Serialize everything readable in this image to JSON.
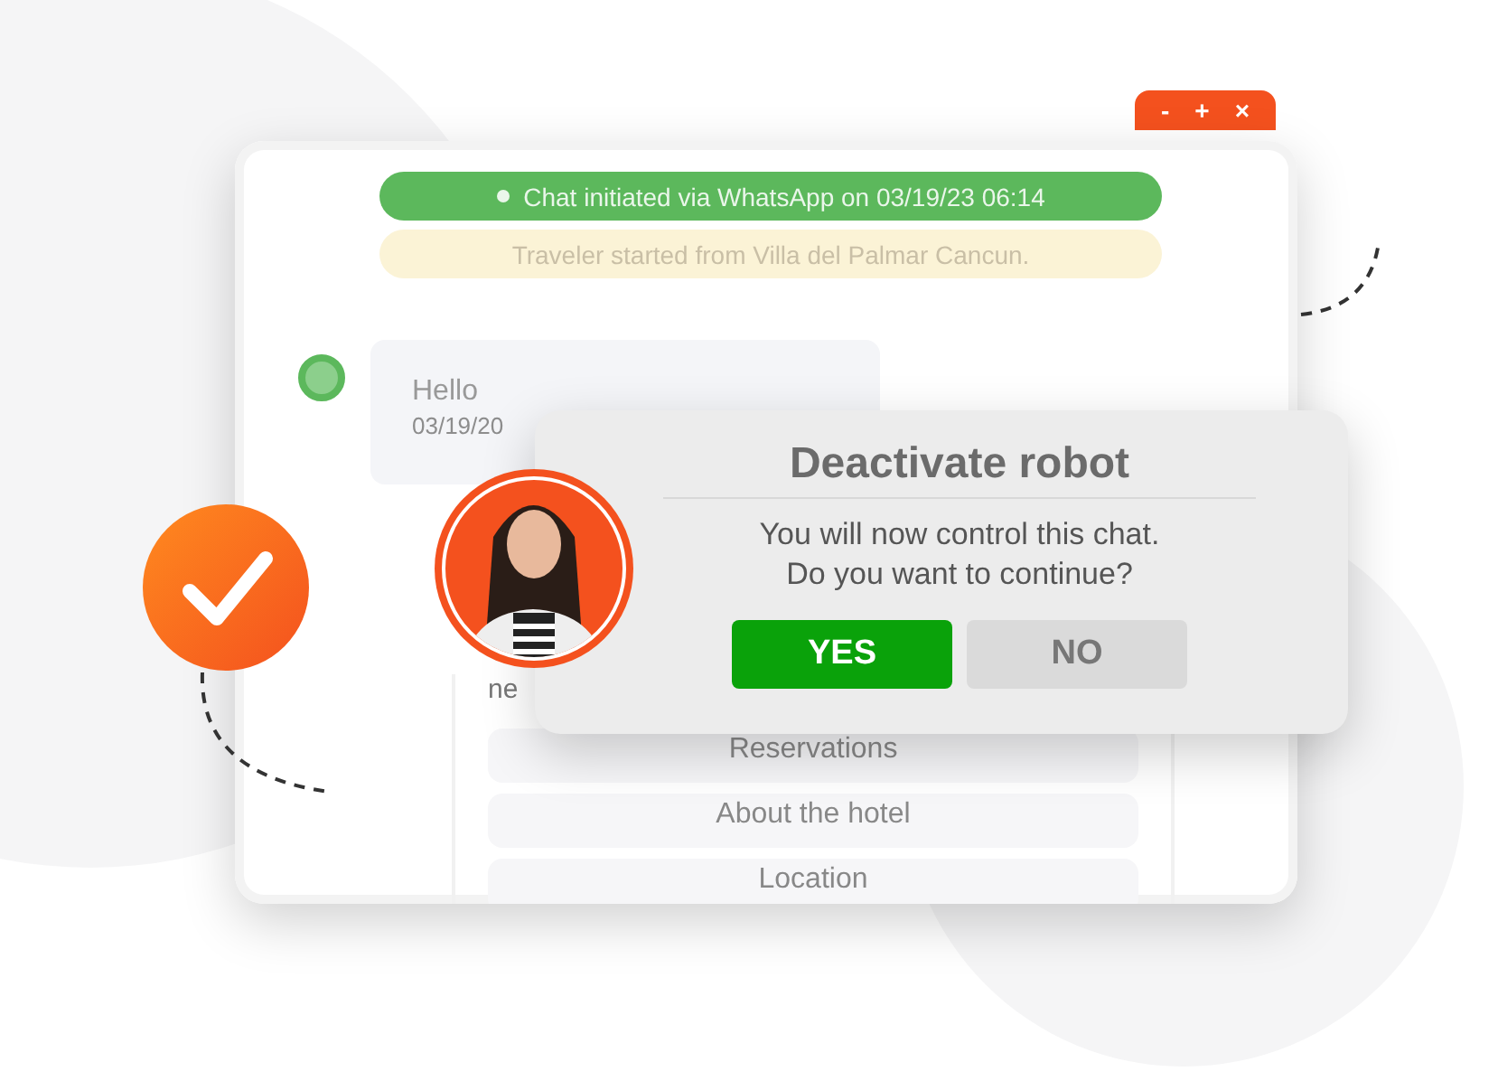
{
  "window_controls": [
    "-",
    "+",
    "×"
  ],
  "chat": {
    "system_notice": "Chat initiated via WhatsApp on 03/19/23  06:14",
    "origin_notice": "Traveler started from Villa del Palmar Cancun.",
    "message": {
      "text": "Hello",
      "time": "03/19/20"
    },
    "partial_text": "ne",
    "options": [
      "Reservations",
      "About the hotel",
      "Location"
    ]
  },
  "dialog": {
    "title": "Deactivate robot",
    "message_lines": [
      "You will now control this chat.",
      "Do you want to continue?"
    ],
    "buttons": [
      {
        "label": "YES",
        "kind": "primary"
      },
      {
        "label": "NO",
        "kind": "secondary"
      }
    ]
  }
}
